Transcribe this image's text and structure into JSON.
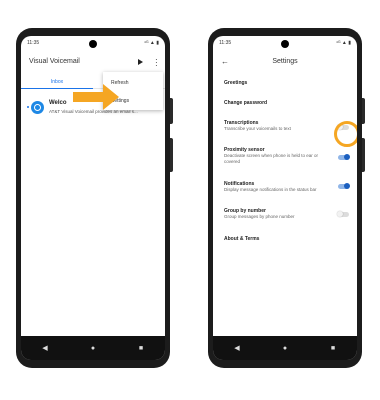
{
  "left_phone": {
    "status": {
      "time": "11:35",
      "icons": "⁴ᴳ ▲ ▮"
    },
    "app_title": "Visual Voicemail",
    "tabs": {
      "inbox": "Inbox"
    },
    "voicemail": {
      "title": "Welco",
      "preview": "AT&T Visual Voicemail provides an email s..."
    },
    "menu": {
      "refresh": "Refresh",
      "settings": "Settings"
    },
    "colors": {
      "accent": "#1a73e8",
      "arrow": "#f5a623"
    }
  },
  "right_phone": {
    "status": {
      "time": "11:35",
      "icons": "⁴ᴳ ▲ ▮"
    },
    "title": "Settings",
    "items": [
      {
        "title": "Greetings",
        "subtitle": ""
      },
      {
        "title": "Change password",
        "subtitle": ""
      },
      {
        "title": "Transcriptions",
        "subtitle": "Transcribe your voicemails to text",
        "toggle": "off"
      },
      {
        "title": "Proximity sensor",
        "subtitle": "Deactivate screen when phone is held to ear or covered",
        "toggle": "on"
      },
      {
        "title": "Notifications",
        "subtitle": "Display message notifications in the status bar",
        "toggle": "on"
      },
      {
        "title": "Group by number",
        "subtitle": "Group messages by phone number",
        "toggle": "off"
      },
      {
        "title": "About & Terms",
        "subtitle": ""
      }
    ],
    "highlight_color": "#f5a623"
  },
  "nav": {
    "back": "◀",
    "home": "●",
    "recents": "■"
  }
}
